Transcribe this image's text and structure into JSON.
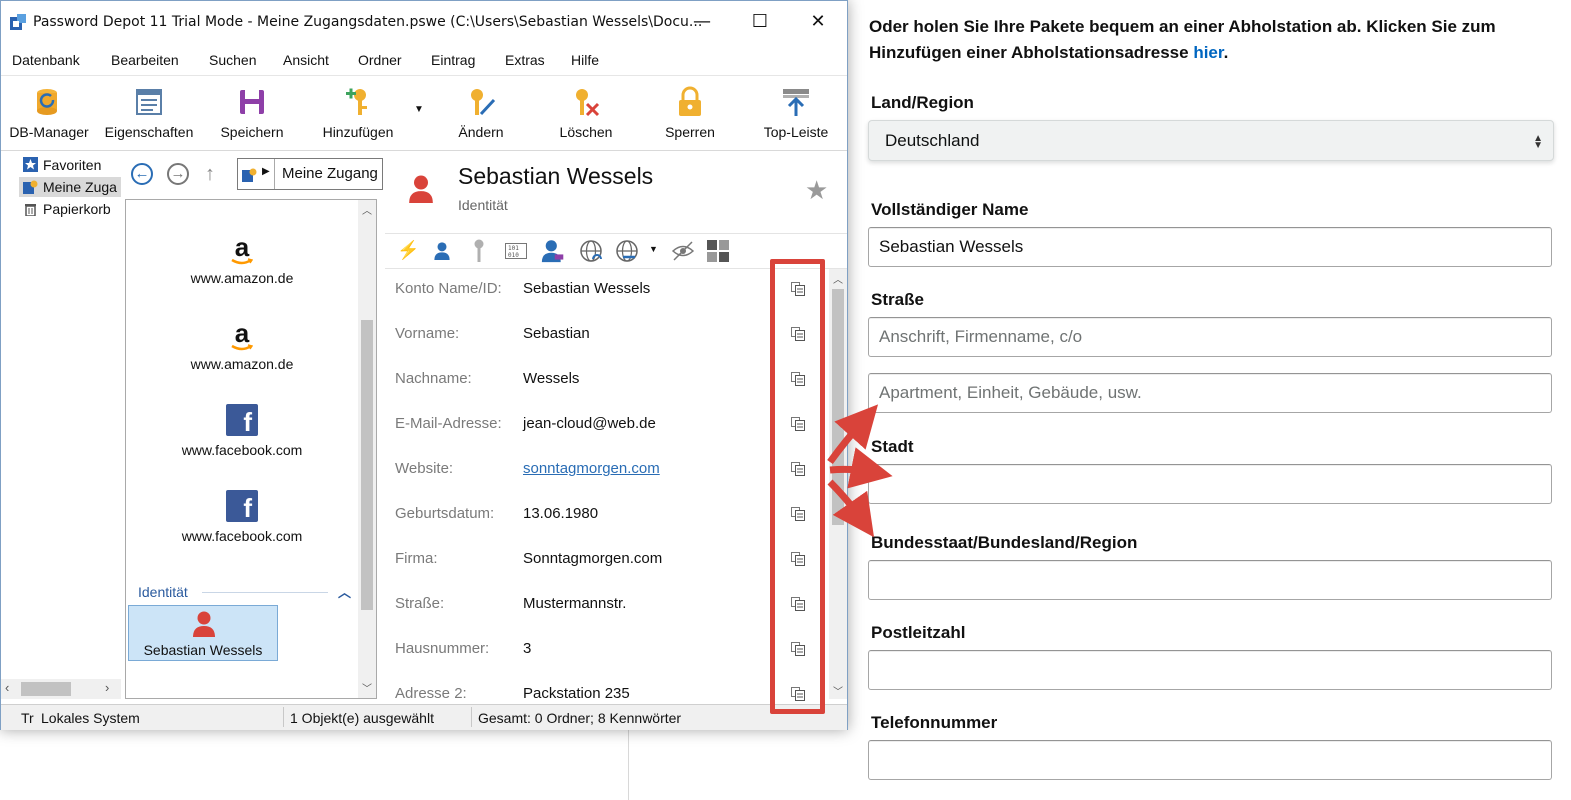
{
  "webform": {
    "intro": "Oder holen Sie Ihre Pakete bequem an einer Abholstation ab. Klicken Sie zum Hinzufügen einer Abholstationsadresse",
    "intro_link": "hier",
    "intro_end": ".",
    "country_label": "Land/Region",
    "country_value": "Deutschland",
    "name_label": "Vollständiger Name",
    "name_value": "Sebastian Wessels",
    "street_label": "Straße",
    "street_placeholder1": "Anschrift, Firmenname, c/o",
    "street_placeholder2": "Apartment, Einheit, Gebäude, usw.",
    "city_label": "Stadt",
    "state_label": "Bundesstaat/Bundesland/Region",
    "zip_label": "Postleitzahl",
    "phone_label": "Telefonnummer"
  },
  "app": {
    "title": "Password Depot 11 Trial Mode - Meine Zugangsdaten.pswe (C:\\Users\\Sebastian Wessels\\Docu...",
    "menu": [
      "Datenbank",
      "Bearbeiten",
      "Suchen",
      "Ansicht",
      "Ordner",
      "Eintrag",
      "Extras",
      "Hilfe"
    ],
    "toolbar": {
      "db_manager": "DB-Manager",
      "properties": "Eigenschaften",
      "save": "Speichern",
      "add": "Hinzufügen",
      "edit": "Ändern",
      "delete": "Löschen",
      "lock": "Sperren",
      "topbar": "Top-Leiste"
    },
    "tree": [
      "Favoriten",
      "Meine Zuga",
      "Papierkorb"
    ],
    "path": "Meine Zugang",
    "list": {
      "items": [
        "www.amazon.de",
        "www.amazon.de",
        "www.facebook.com",
        "www.facebook.com"
      ],
      "group_label": "Identität",
      "selected": "Sebastian Wessels"
    },
    "detail": {
      "name": "Sebastian Wessels",
      "type": "Identität",
      "fields": [
        {
          "label": "Konto Name/ID:",
          "value": "Sebastian Wessels"
        },
        {
          "label": "Vorname:",
          "value": "Sebastian"
        },
        {
          "label": "Nachname:",
          "value": "Wessels"
        },
        {
          "label": "E-Mail-Adresse:",
          "value": "jean-cloud@web.de"
        },
        {
          "label": "Website:",
          "value": "sonntagmorgen.com"
        },
        {
          "label": "Geburtsdatum:",
          "value": "13.06.1980"
        },
        {
          "label": "Firma:",
          "value": "Sonntagmorgen.com"
        },
        {
          "label": "Straße:",
          "value": "Mustermannstr."
        },
        {
          "label": "Hausnummer:",
          "value": "3"
        },
        {
          "label": "Adresse 2:",
          "value": "Packstation 235"
        }
      ]
    },
    "status": {
      "left_prefix": "Tr",
      "system": "Lokales System",
      "selected": "1 Objekt(e) ausgewählt",
      "total": "Gesamt: 0 Ordner; 8 Kennwörter"
    }
  },
  "colors": {
    "annotation_red": "#d9433a",
    "link_blue": "#0066c0",
    "facebook_blue": "#3b5998",
    "key_gold": "#f0b030"
  }
}
